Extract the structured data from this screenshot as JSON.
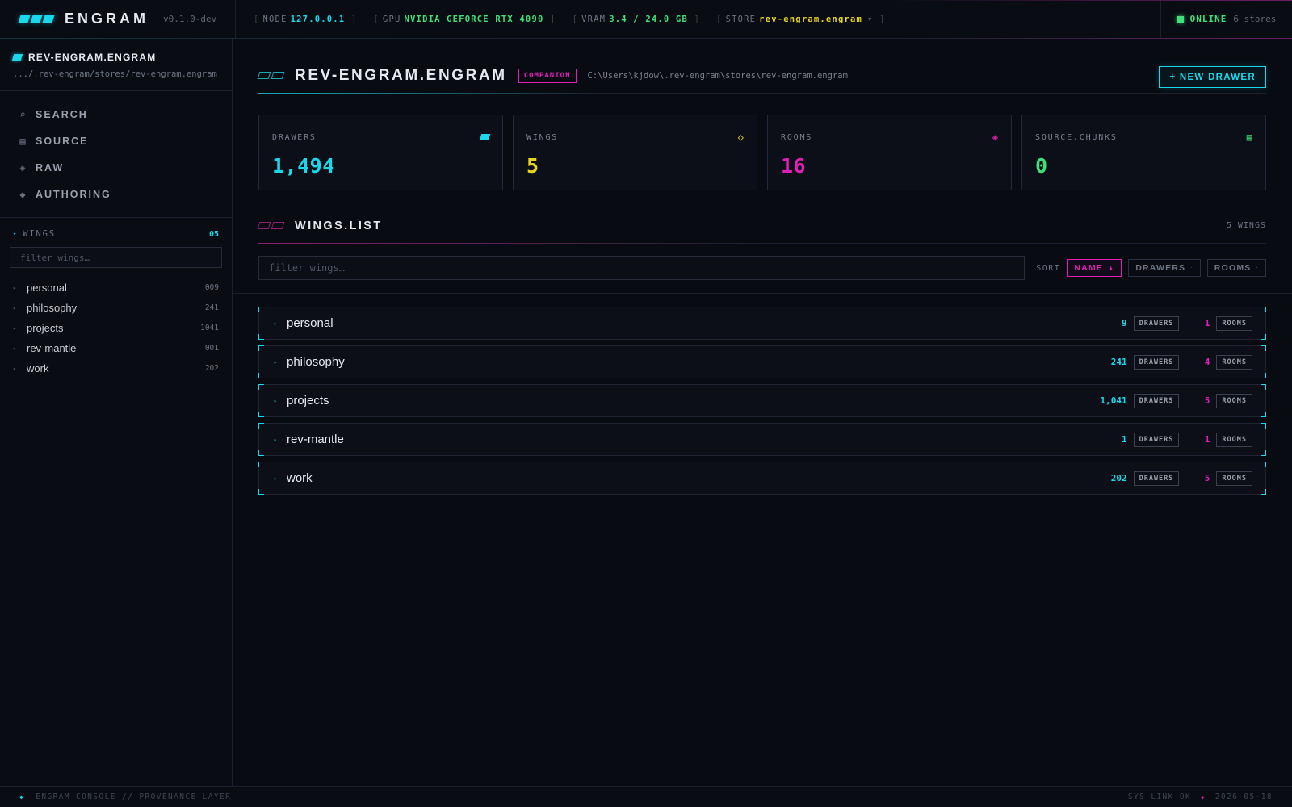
{
  "app": {
    "name": "ENGRAM",
    "version": "v0.1.0-dev"
  },
  "status": {
    "node_label": "NODE",
    "node_value": "127.0.0.1",
    "gpu_label": "GPU",
    "gpu_value": "NVIDIA GEFORCE RTX 4090",
    "vram_label": "VRAM",
    "vram_value": "3.4 / 24.0 GB",
    "store_label": "STORE",
    "store_value": "rev-engram.engram",
    "online_label": "ONLINE",
    "stores_count": "6 stores"
  },
  "sidebar": {
    "store_name": "REV-ENGRAM.ENGRAM",
    "store_path": ".../.rev-engram/stores/rev-engram.engram",
    "nav": [
      {
        "label": "SEARCH",
        "icon": "search-icon"
      },
      {
        "label": "SOURCE",
        "icon": "source-icon"
      },
      {
        "label": "RAW",
        "icon": "raw-icon"
      },
      {
        "label": "AUTHORING",
        "icon": "authoring-icon"
      }
    ],
    "wings_label": "WINGS",
    "wings_count": "05",
    "filter_placeholder": "filter wings…",
    "wings": [
      {
        "name": "personal",
        "count": "009"
      },
      {
        "name": "philosophy",
        "count": "241"
      },
      {
        "name": "projects",
        "count": "1041"
      },
      {
        "name": "rev-mantle",
        "count": "001"
      },
      {
        "name": "work",
        "count": "202"
      }
    ]
  },
  "header": {
    "title": "REV-ENGRAM.ENGRAM",
    "badge": "COMPANION",
    "path": "C:\\Users\\kjdow\\.rev-engram\\stores\\rev-engram.engram",
    "new_drawer": "+ NEW DRAWER"
  },
  "stats": [
    {
      "label": "DRAWERS",
      "value": "1,494",
      "color": "#19d8ec",
      "icon": "drawer-icon"
    },
    {
      "label": "WINGS",
      "value": "5",
      "color": "#e8d51f",
      "icon": "wing-icon"
    },
    {
      "label": "ROOMS",
      "value": "16",
      "color": "#e01fb7",
      "icon": "room-icon"
    },
    {
      "label": "SOURCE.CHUNKS",
      "value": "0",
      "color": "#3ee07a",
      "icon": "chunks-icon"
    }
  ],
  "wings_list": {
    "title": "WINGS.LIST",
    "count_label": "5 WINGS",
    "filter_placeholder": "filter wings…",
    "sort_label": "SORT",
    "sort_options": [
      {
        "label": "NAME",
        "active": true,
        "direction": "▲"
      },
      {
        "label": "DRAWERS",
        "active": false
      },
      {
        "label": "ROOMS",
        "active": false
      }
    ],
    "drawers_tag": "DRAWERS",
    "rooms_tag": "ROOMS",
    "rows": [
      {
        "name": "personal",
        "drawers": "9",
        "rooms": "1"
      },
      {
        "name": "philosophy",
        "drawers": "241",
        "rooms": "4"
      },
      {
        "name": "projects",
        "drawers": "1,041",
        "rooms": "5"
      },
      {
        "name": "rev-mantle",
        "drawers": "1",
        "rooms": "1"
      },
      {
        "name": "work",
        "drawers": "202",
        "rooms": "5"
      }
    ]
  },
  "footer": {
    "left": "ENGRAM CONSOLE // PROVENANCE LAYER",
    "link": "SYS_LINK_OK",
    "date": "2026-05-18"
  },
  "colors": {
    "accent_cyan": "#19d8ec",
    "accent_magenta": "#e01fb7",
    "accent_yellow": "#e8d51f",
    "accent_green": "#3ee07a",
    "background": "#080b12"
  }
}
